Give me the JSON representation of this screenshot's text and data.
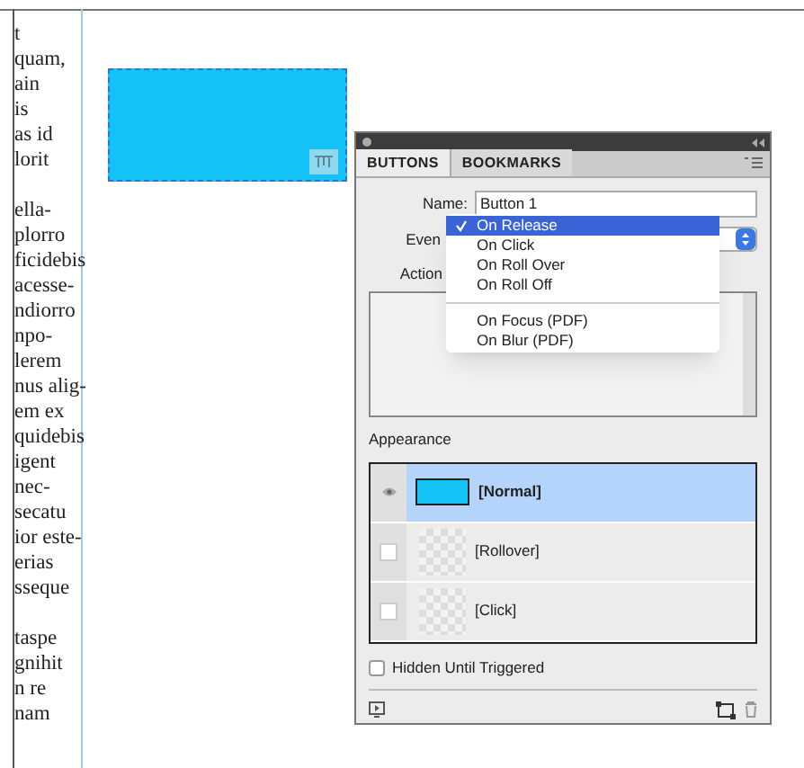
{
  "document": {
    "paragraphs": [
      [
        "t",
        "quam,",
        "ain",
        "is",
        "as id",
        "lorit"
      ],
      [
        "ella-",
        "plorro",
        "ficidebis",
        "acesse-",
        "ndiorro",
        "npo-",
        "lerem",
        "nus alig-",
        "em ex",
        "quidebis",
        "igent",
        "nec-",
        "secatu",
        "ior este-",
        "erias",
        "sseque"
      ],
      [
        "taspe",
        "gnihit",
        "n re",
        "nam"
      ]
    ]
  },
  "panel": {
    "tabs": [
      {
        "label": "BUTTONS",
        "selected": true
      },
      {
        "label": "BOOKMARKS",
        "selected": false
      }
    ],
    "name_label": "Name:",
    "name_value": "Button 1",
    "event_label": "Even",
    "actions_label": "Action",
    "event_menu": {
      "groups": [
        [
          {
            "label": "On Release",
            "selected": true
          },
          {
            "label": "On Click",
            "selected": false
          },
          {
            "label": "On Roll Over",
            "selected": false
          },
          {
            "label": "On Roll Off",
            "selected": false
          }
        ],
        [
          {
            "label": "On Focus (PDF)",
            "selected": false
          },
          {
            "label": "On Blur (PDF)",
            "selected": false
          }
        ]
      ]
    },
    "appearance": {
      "label": "Appearance",
      "states": [
        {
          "label": "[Normal]",
          "selected": true,
          "visible": true,
          "kind": "filled"
        },
        {
          "label": "[Rollover]",
          "selected": false,
          "visible": false,
          "kind": "empty"
        },
        {
          "label": "[Click]",
          "selected": false,
          "visible": false,
          "kind": "empty"
        }
      ]
    },
    "hidden_until_triggered": {
      "label": "Hidden Until Triggered",
      "checked": false
    }
  }
}
